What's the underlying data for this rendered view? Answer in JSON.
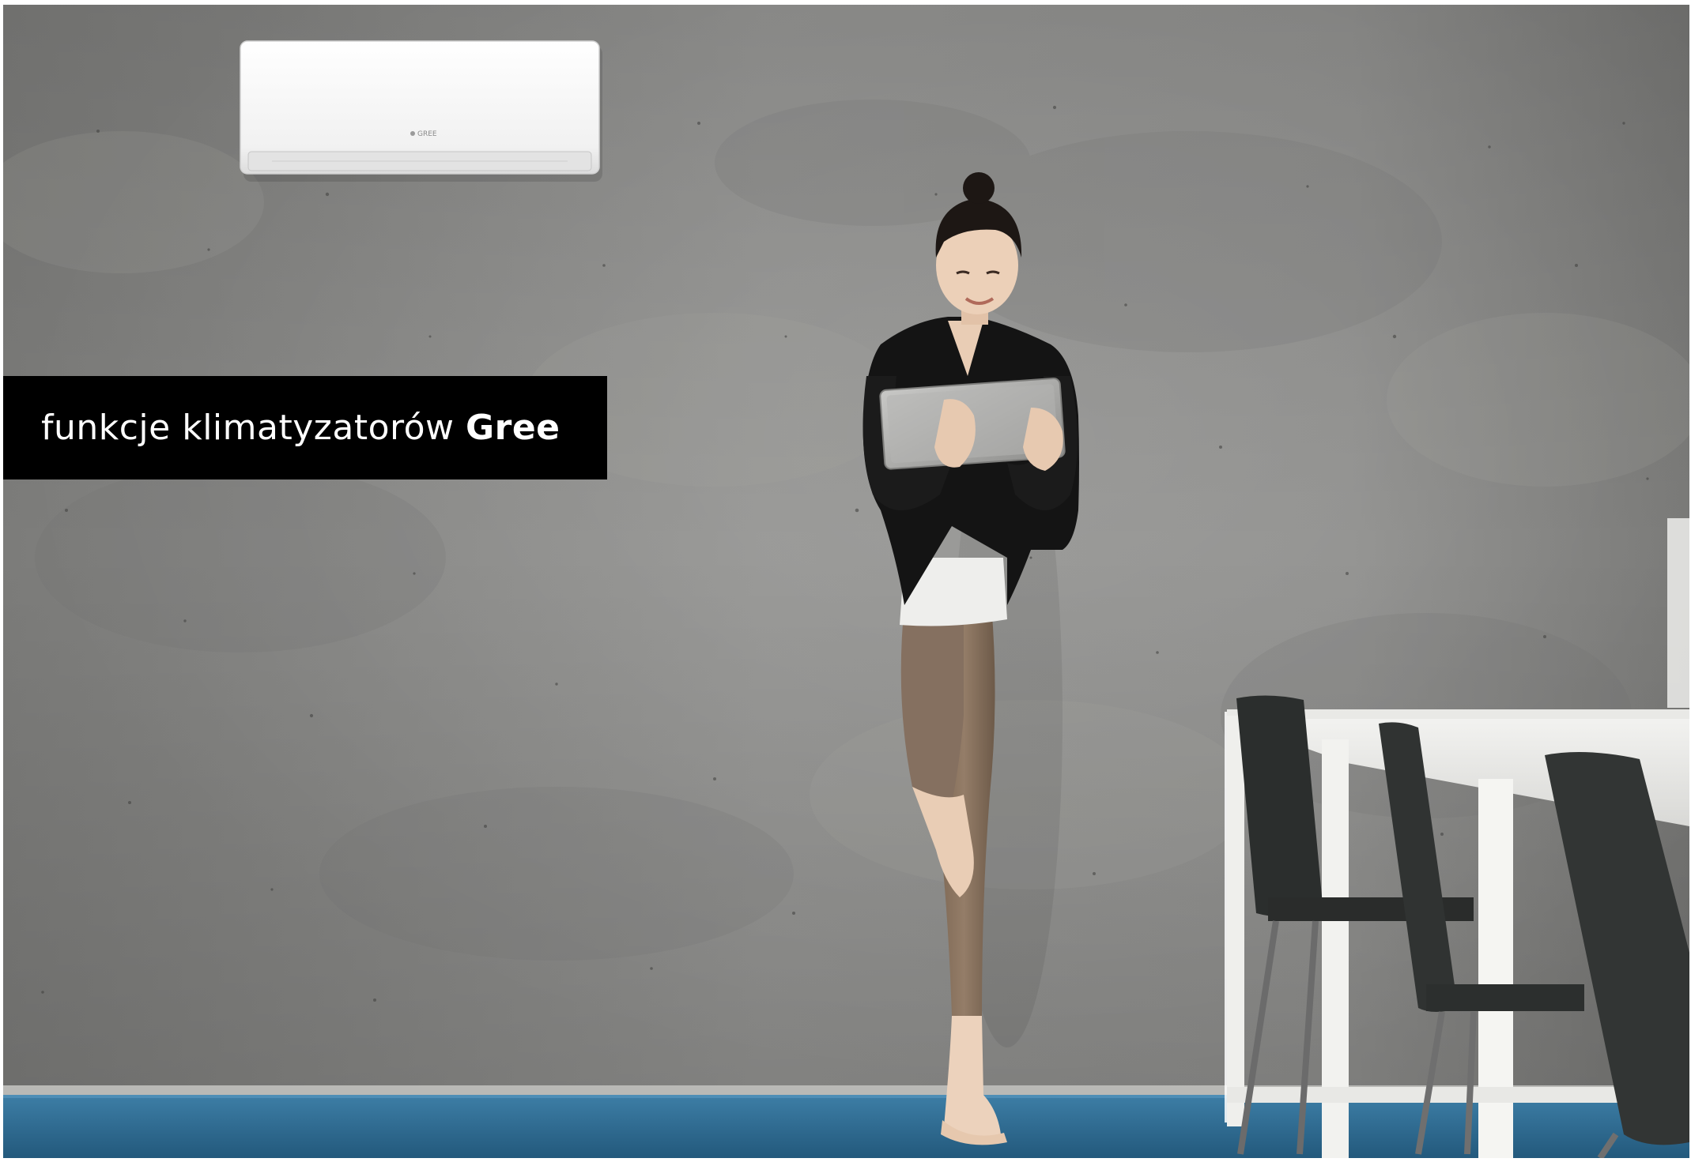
{
  "banner": {
    "text_light": "funkcje klimatyzatorów ",
    "text_bold": "Gree"
  },
  "ac_unit": {
    "brand_label": "GREE"
  },
  "colors": {
    "banner_background": "#000000",
    "banner_text": "#ffffff",
    "wall": "#8c8c8a",
    "floor": "#2f6f97"
  }
}
